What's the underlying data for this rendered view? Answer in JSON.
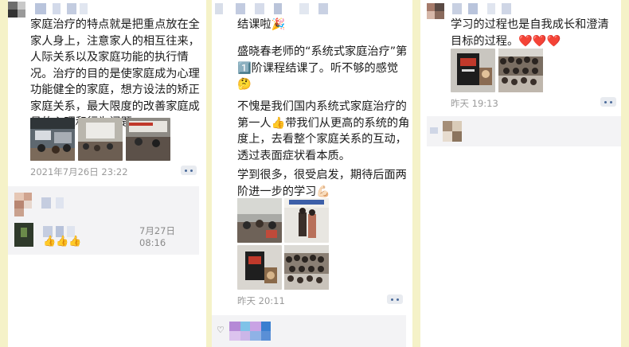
{
  "post1": {
    "text": "家庭治疗的特点就是把重点放在全家人身上，注意家人的相互往来，人际关系以及家庭功能的执行情况。治疗的目的是使家庭成为心理功能健全的家庭，想方设法的矫正家庭关系，最大限度的改善家庭成员的心理和行为问题",
    "time": "2021年7月26日 23:22",
    "comment_time": "7月27日 08:16",
    "comment_emoji": "👍👍👍"
  },
  "post2": {
    "line1": "结课啦🎉",
    "para1": "盛晓春老师的“系统式家庭治疗”第1️⃣阶课程结课了。听不够的感觉🤔",
    "para2": "不愧是我们国内系统式家庭治疗的第一人👍带我们从更高的系统的角度上，去看整个家庭关系的互动，透过表面症状看本质。",
    "para3": "学到很多，很受启发，期待后面两阶进一步的学习💪🏻",
    "time": "昨天 20:11"
  },
  "post3": {
    "text": "学习的过程也是自我成长和澄清目标的过程。❤️❤️❤️",
    "time": "昨天 19:13"
  },
  "colors": {
    "background": "#f5f2c8",
    "panel": "#ffffff",
    "time_text": "#9a9a9a",
    "more_button": "#e8ebf0"
  }
}
